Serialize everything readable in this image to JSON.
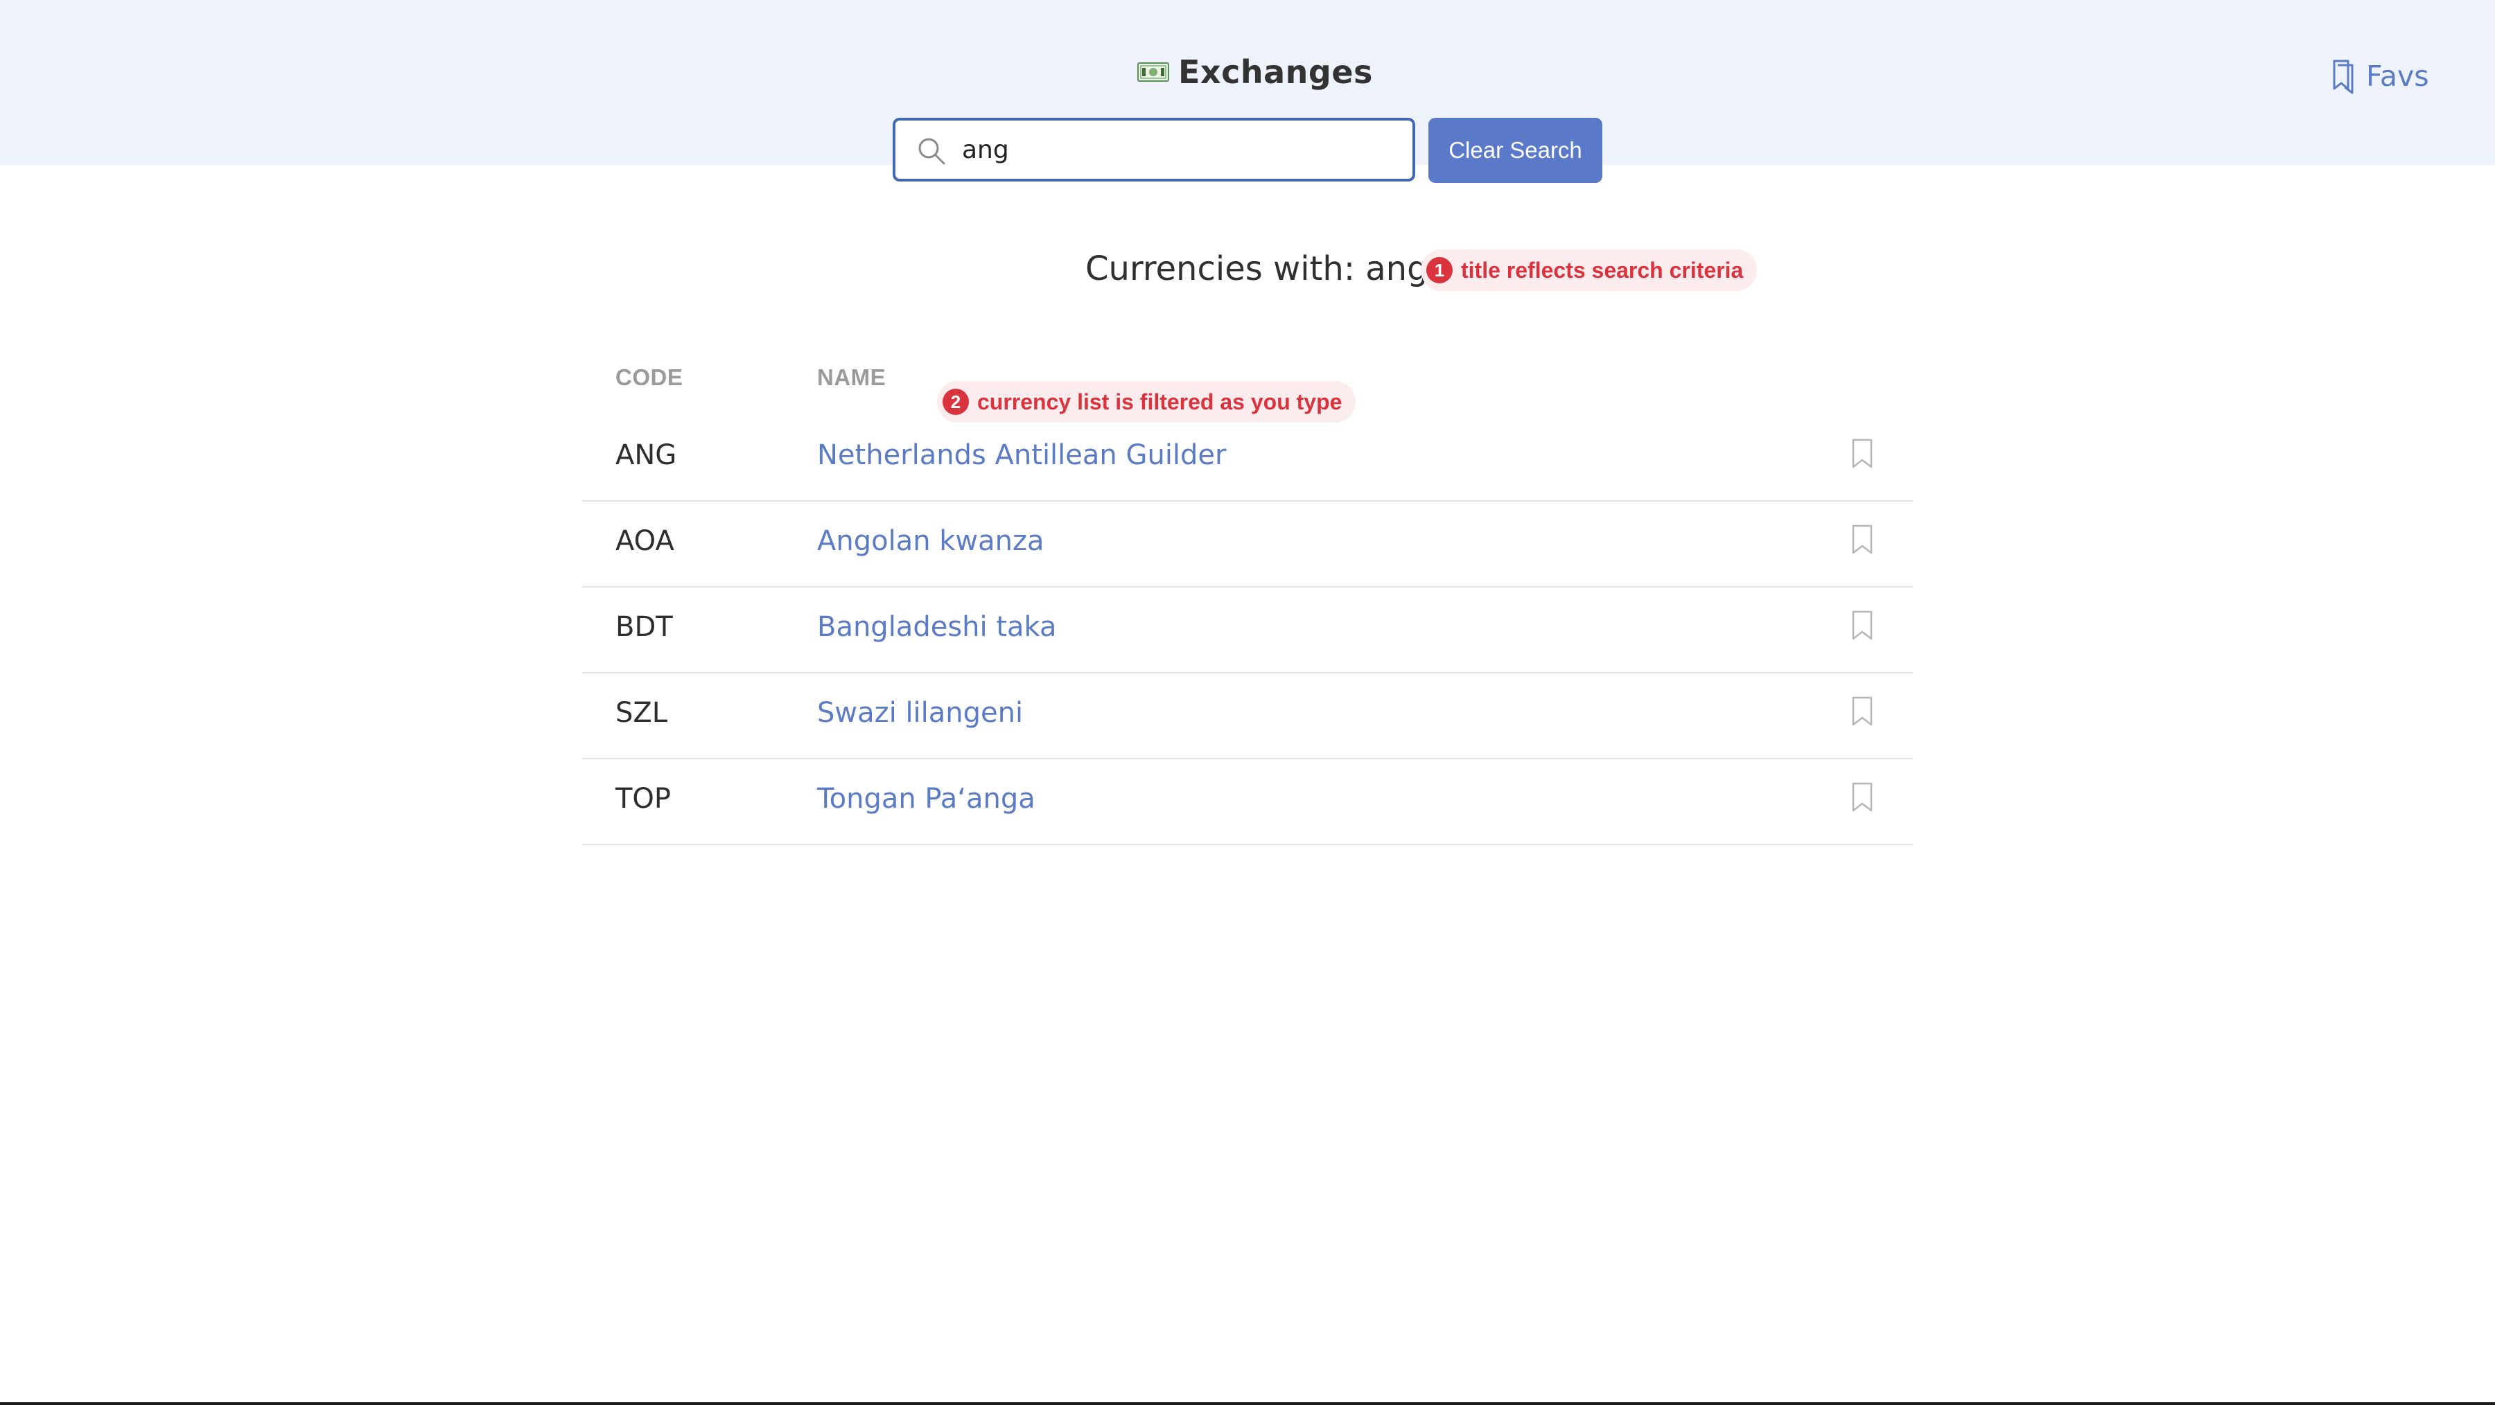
{
  "header": {
    "title": "Exchanges",
    "logo_icon": "money-bill-icon",
    "favs_label": "Favs",
    "favs_icon": "bookmark-icon"
  },
  "search": {
    "value": "ang",
    "placeholder": "",
    "icon": "search-icon",
    "clear_label": "Clear Search"
  },
  "main": {
    "title": "Currencies with: ang"
  },
  "annotations": [
    {
      "number": "1",
      "text": "title reflects search criteria"
    },
    {
      "number": "2",
      "text": "currency list is filtered as you type"
    }
  ],
  "table": {
    "columns": [
      "CODE",
      "NAME"
    ],
    "rows": [
      {
        "code": "ANG",
        "name": "Netherlands Antillean Guilder"
      },
      {
        "code": "AOA",
        "name": "Angolan kwanza"
      },
      {
        "code": "BDT",
        "name": "Bangladeshi taka"
      },
      {
        "code": "SZL",
        "name": "Swazi lilangeni"
      },
      {
        "code": "TOP",
        "name": "Tongan Paʻanga"
      }
    ]
  },
  "colors": {
    "accent": "#5a79c9",
    "link": "#5b7bc4",
    "header_bg": "#eef2fa",
    "annotation": "#d9343e",
    "focus_border": "#4169b3"
  }
}
